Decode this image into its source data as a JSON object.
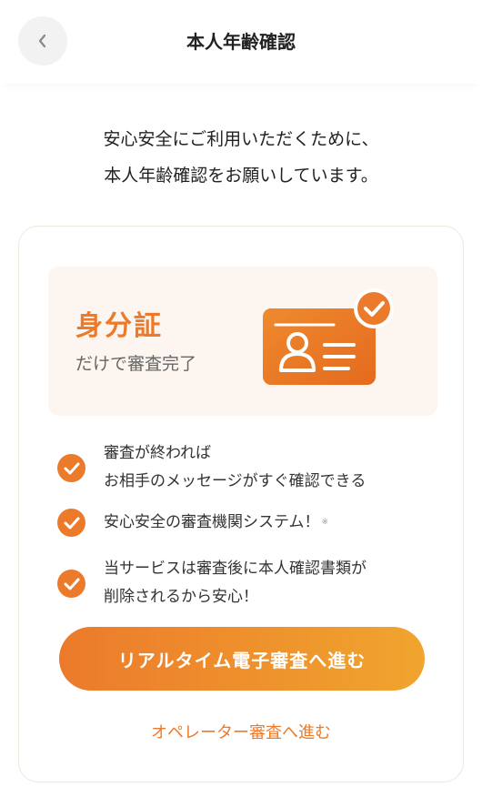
{
  "header": {
    "title": "本人年齢確認",
    "back_icon": "chevron-left-icon"
  },
  "intro": {
    "line1": "安心安全にご利用いただくために、",
    "line2": "本人年齢確認をお願いしています。"
  },
  "promo": {
    "title": "身分証",
    "subtitle": "だけで審査完了",
    "icon": "id-card-check-icon"
  },
  "benefits": [
    {
      "line1": "審査が終われば",
      "line2": "お相手のメッセージがすぐ確認できる"
    },
    {
      "line1": "安心安全の審査機関システム！",
      "note": "※"
    },
    {
      "line1": "当サービスは審査後に本人確認書類が",
      "line2": "削除されるから安心！"
    }
  ],
  "actions": {
    "primary": "リアルタイム電子審査へ進む",
    "secondary": "オペレーター審査へ進む"
  },
  "colors": {
    "accent": "#ec7a2b",
    "accent_end": "#f0a52e",
    "promo_bg": "#fdf5ef"
  }
}
